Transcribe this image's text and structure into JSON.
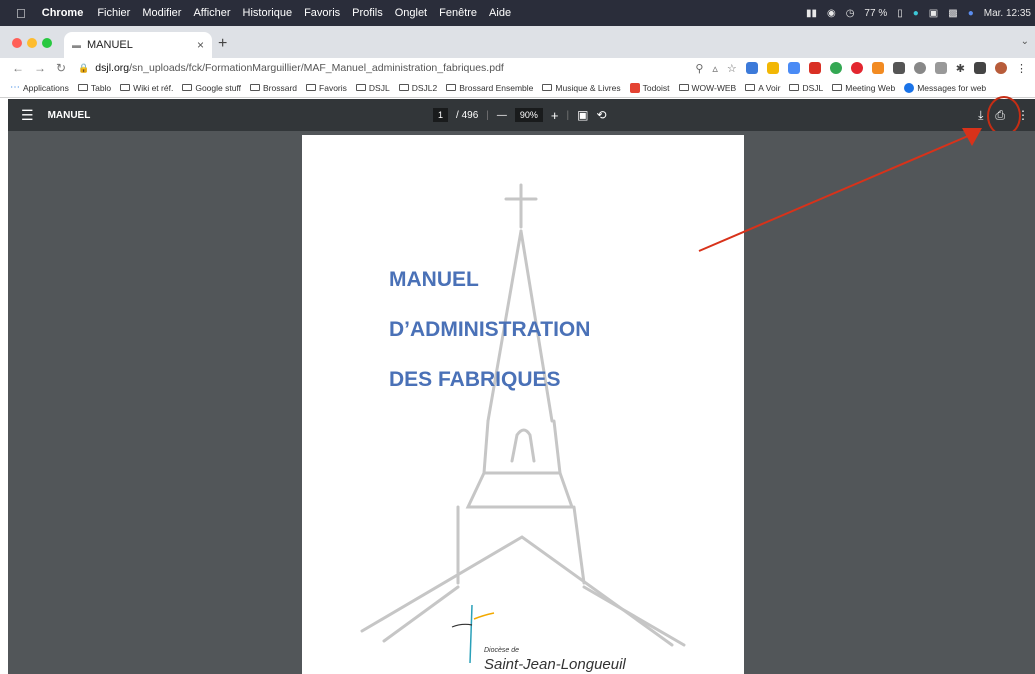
{
  "menubar": {
    "app": "Chrome",
    "items": [
      "Fichier",
      "Modifier",
      "Afficher",
      "Historique",
      "Favoris",
      "Profils",
      "Onglet",
      "Fenêtre",
      "Aide"
    ],
    "battery": "77 %",
    "clock": "Mar. 12:35"
  },
  "tab": {
    "title": "MANUEL",
    "close": "×",
    "new": "+"
  },
  "address": {
    "domain": "dsjl.org",
    "path": "/sn_uploads/fck/FormationMarguillier/MAF_Manuel_administration_fabriques.pdf"
  },
  "bookmarks": [
    "Applications",
    "Tablo",
    "Wiki et réf.",
    "Google stuff",
    "Brossard",
    "Favoris",
    "DSJL",
    "DSJL2",
    "Brossard Ensemble",
    "Musique & Livres",
    "Todoist",
    "WOW-WEB",
    "A Voir",
    "DSJL",
    "Meeting Web",
    "Messages for web"
  ],
  "pdf": {
    "title": "MANUEL",
    "page_current": "1",
    "page_total": "/ 496",
    "zoom": "90%",
    "minus": "—",
    "plus": "+"
  },
  "document": {
    "line1": "MANUEL",
    "line2": "D’ADMINISTRATION",
    "line3": "DES FABRIQUES",
    "logo_small": "Diocèse de",
    "logo_big": "Saint-Jean-Longueuil"
  },
  "colors": {
    "accent_blue": "#4a71b7",
    "annotation_red": "#c62d14",
    "pdf_toolbar": "#323639",
    "pdf_bg": "#525659"
  },
  "icons": [
    "apple-icon",
    "wifi-icon",
    "battery-icon",
    "lock-icon",
    "star-icon",
    "download-icon",
    "print-icon",
    "more-icon",
    "hamburger-icon",
    "fit-page-icon",
    "rotate-icon"
  ]
}
